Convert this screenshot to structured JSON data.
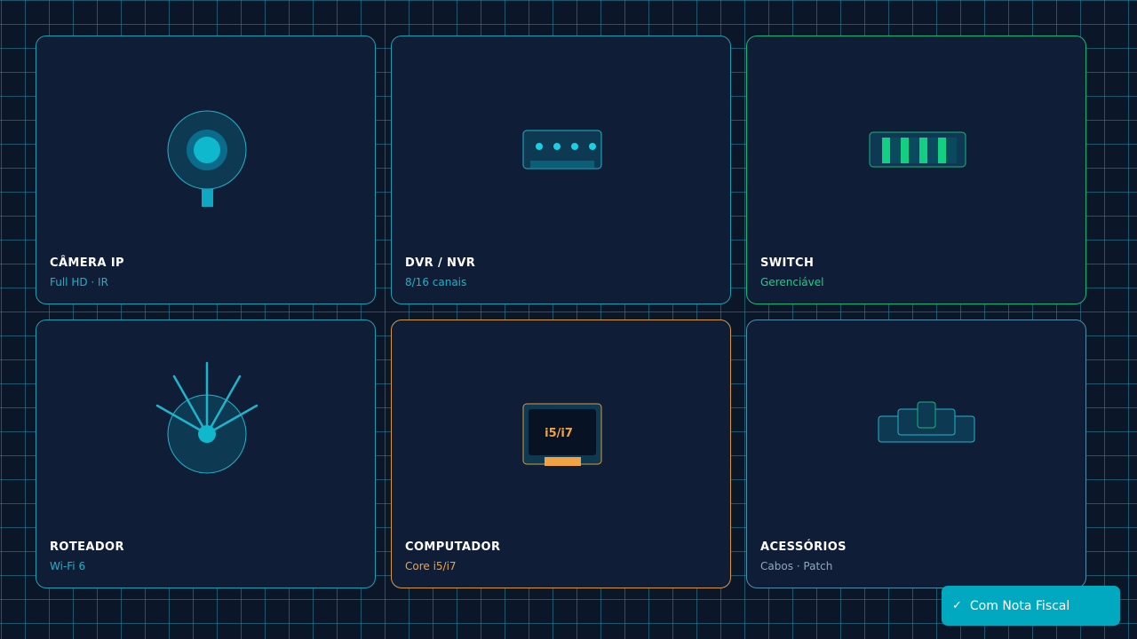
{
  "cards": [
    {
      "title": "CÂMERA IP",
      "subtitle": "Full HD · IR",
      "icon": "camera-icon"
    },
    {
      "title": "DVR / NVR",
      "subtitle": "8/16 canais",
      "icon": "dvr-icon"
    },
    {
      "title": "SWITCH",
      "subtitle": "Gerenciável",
      "icon": "switch-icon"
    },
    {
      "title": "ROTEADOR",
      "subtitle": "Wi-Fi 6",
      "icon": "router-icon"
    },
    {
      "title": "COMPUTADOR",
      "subtitle": "Core i5/i7",
      "icon": "computer-icon",
      "screen_label": "i5/i7"
    },
    {
      "title": "ACESSÓRIOS",
      "subtitle": "Cabos · Patch",
      "icon": "accessories-icon"
    }
  ],
  "badge": {
    "check": "✓",
    "label": "Com Nota Fiscal"
  },
  "colors": {
    "background": "#0b1628",
    "card": "#0f1e36",
    "cyan": "#1f9fb5",
    "green": "#14b878",
    "orange": "#d99a3d",
    "slate": "#4f8eaa",
    "badge": "#00a9c0"
  }
}
